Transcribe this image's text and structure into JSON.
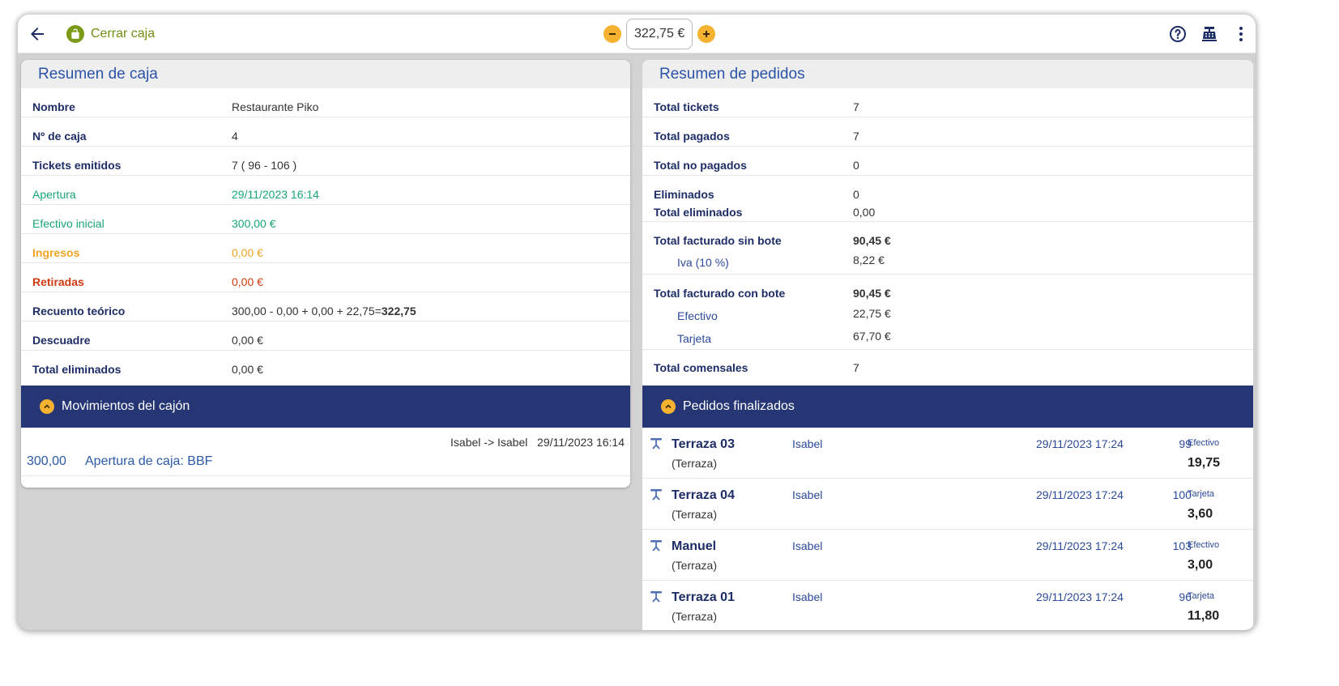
{
  "topbar": {
    "title": "Cerrar caja",
    "amount": "322,75 €",
    "icons": [
      "arrow-left-icon",
      "lock-open-icon",
      "minus-icon",
      "plus-icon",
      "help-circle-icon",
      "cash-register-icon",
      "more-vertical-icon"
    ]
  },
  "colors": {
    "accent_green": "#6f8f12",
    "accent_orange": "#f5b130",
    "navy": "#263674",
    "link_blue": "#2b53a7",
    "status_green": "#17a576",
    "status_orange": "#f2a323",
    "status_red": "#cf3a10"
  },
  "left": {
    "title": "Resumen de caja",
    "rows": [
      {
        "label": "Nombre",
        "value": "Restaurante Piko"
      },
      {
        "label": "Nº de caja",
        "value": "4"
      },
      {
        "label": "Tickets emitidos",
        "value": "7 ( 96 - 106 )"
      },
      {
        "label": "Apertura",
        "value": "29/11/2023 16:14"
      },
      {
        "label": "Efectivo inicial",
        "value": "300,00 €"
      },
      {
        "label": "Ingresos",
        "value": "0,00 €"
      },
      {
        "label": "Retiradas",
        "value": "0,00 €"
      },
      {
        "label": "Recuento teórico",
        "value_formula": "300,00 - 0,00 + 0,00 + 22,75=",
        "value_result": "322,75"
      },
      {
        "label": "Descuadre",
        "value": "0,00 €"
      },
      {
        "label": "Total eliminados",
        "value": "0,00 €"
      }
    ],
    "section_title": "Movimientos del cajón",
    "movements": [
      {
        "meta": "Isabel -> Isabel   29/11/2023 16:14",
        "amount": "300,00",
        "description": "Apertura de caja: BBF"
      }
    ]
  },
  "right": {
    "title": "Resumen de pedidos",
    "rows": {
      "total_tickets": {
        "label": "Total tickets",
        "value": "7"
      },
      "total_pagados": {
        "label": "Total pagados",
        "value": "7"
      },
      "total_no_pagados": {
        "label": "Total no pagados",
        "value": "0"
      },
      "eliminados": {
        "label": "Eliminados",
        "value": "0",
        "label2": "Total eliminados",
        "value2": "0,00"
      },
      "sin_bote": {
        "label": "Total facturado sin bote",
        "value": "90,45 €",
        "sub_label": "Iva (10 %)",
        "sub_value": "8,22 €"
      },
      "con_bote": {
        "label": "Total facturado con bote",
        "value": "90,45 €",
        "sub1_label": "Efectivo",
        "sub1_value": "22,75 €",
        "sub2_label": "Tarjeta",
        "sub2_value": "67,70 €"
      },
      "comensales": {
        "label": "Total comensales",
        "value": "7"
      }
    },
    "section_title": "Pedidos finalizados",
    "orders": [
      {
        "name": "Terraza 03",
        "zone": "(Terraza)",
        "user": "Isabel",
        "date": "29/11/2023 17:24",
        "number": "99",
        "payment": "Efectivo",
        "total": "19,75"
      },
      {
        "name": "Terraza 04",
        "zone": "(Terraza)",
        "user": "Isabel",
        "date": "29/11/2023 17:24",
        "number": "100",
        "payment": "Tarjeta",
        "total": "3,60"
      },
      {
        "name": "Manuel",
        "zone": "(Terraza)",
        "user": "Isabel",
        "date": "29/11/2023 17:24",
        "number": "103",
        "payment": "Efectivo",
        "total": "3,00"
      },
      {
        "name": "Terraza 01",
        "zone": "(Terraza)",
        "user": "Isabel",
        "date": "29/11/2023 17:24",
        "number": "96",
        "payment": "Tarjeta",
        "total": "11,80"
      }
    ]
  }
}
